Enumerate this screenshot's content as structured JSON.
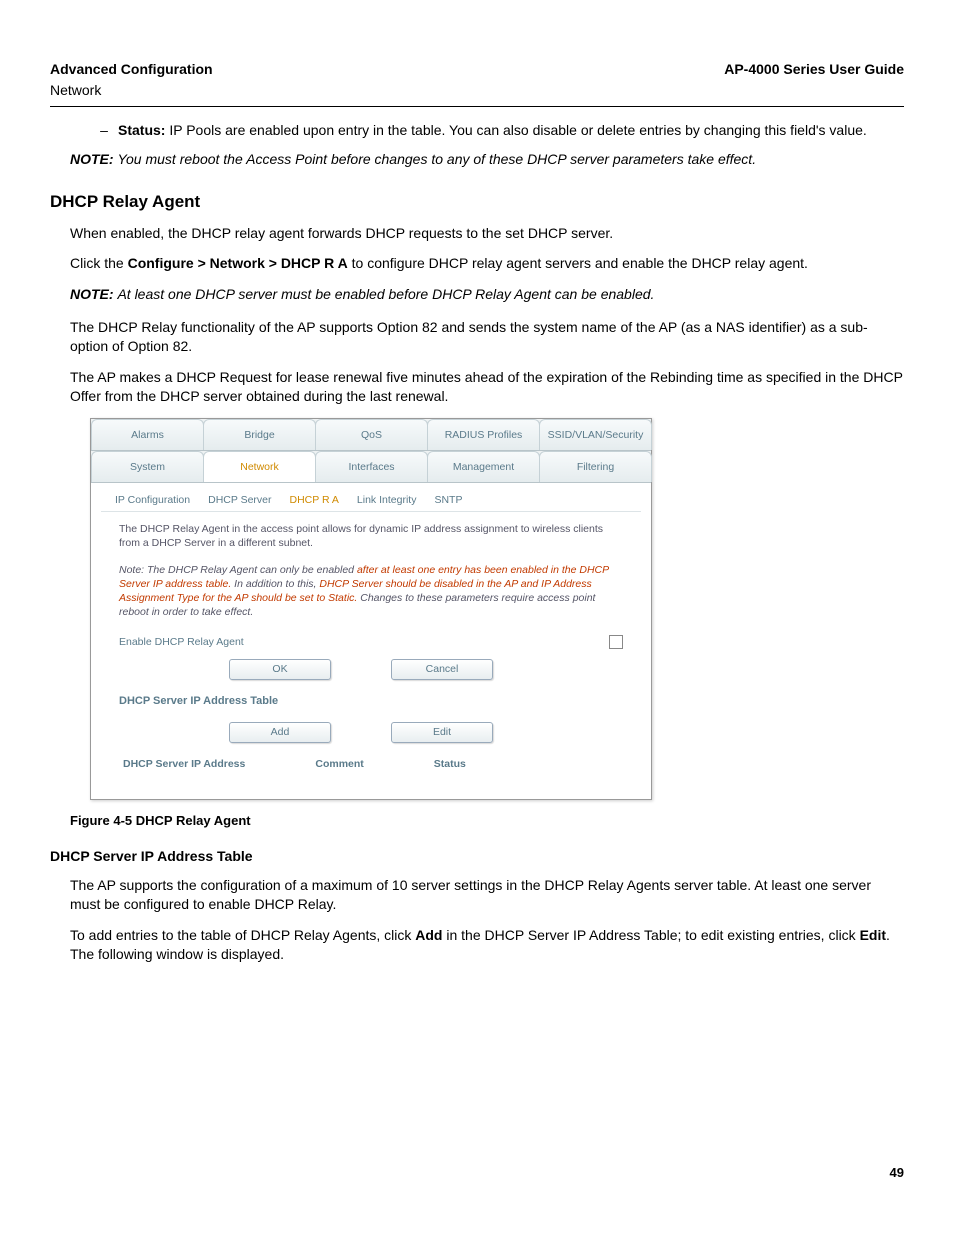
{
  "header": {
    "left": "Advanced Configuration",
    "right": "AP-4000 Series User Guide",
    "sub": "Network"
  },
  "status_item": {
    "label": "Status:",
    "text": " IP Pools are enabled upon entry in the table. You can also disable or delete entries by changing this field's value."
  },
  "note1": {
    "label": "NOTE:  ",
    "text": "You must reboot the Access Point before changes to any of these DHCP server parameters take effect."
  },
  "section_title": "DHCP Relay Agent",
  "p1": "When enabled, the DHCP relay agent forwards DHCP requests to the set DHCP server.",
  "p2a": "Click the ",
  "p2b": "Configure > Network > DHCP R A",
  "p2c": " to configure DHCP relay agent servers and enable the DHCP relay agent.",
  "note2": {
    "label": "NOTE:  ",
    "text": "At least one DHCP server must be enabled before DHCP Relay Agent can be enabled."
  },
  "p3": "The DHCP Relay functionality of the AP supports Option 82 and sends the system name of the AP (as a NAS identifier) as a sub-option of Option 82.",
  "p4": "The AP makes a DHCP Request for lease renewal five minutes ahead of the expiration of the Rebinding time as specified in the DHCP Offer from the DHCP server obtained during the last renewal.",
  "shot": {
    "tabs_top": [
      "Alarms",
      "Bridge",
      "QoS",
      "RADIUS Profiles",
      "SSID/VLAN/Security"
    ],
    "tabs_bot": [
      "System",
      "Network",
      "Interfaces",
      "Management",
      "Filtering"
    ],
    "tabs_bot_active": "Network",
    "subtabs": [
      "IP Configuration",
      "DHCP Server",
      "DHCP R A",
      "Link Integrity",
      "SNTP"
    ],
    "subtab_active": "DHCP R A",
    "intro": "The DHCP Relay Agent in the access point allows for dynamic IP address assignment to wireless clients from a DHCP Server in a different subnet.",
    "note_pre": "Note: The DHCP Relay Agent can only be enabled ",
    "note_red1": "after at least one entry has been enabled in the DHCP Server IP address table.",
    "note_mid": " In addition to this, ",
    "note_red2": "DHCP Server should be disabled in the AP and IP Address Assignment Type for the AP should be set to Static.",
    "note_post": " Changes to these parameters require access point reboot in order to take effect.",
    "enable_label": "Enable DHCP Relay Agent",
    "btn_ok": "OK",
    "btn_cancel": "Cancel",
    "table_title": "DHCP Server IP Address Table",
    "btn_add": "Add",
    "btn_edit": "Edit",
    "col1": "DHCP Server IP Address",
    "col2": "Comment",
    "col3": "Status"
  },
  "fig_caption": "Figure 4-5 DHCP Relay Agent",
  "sub_heading": "DHCP Server IP Address Table",
  "p5": "The AP supports the configuration of a maximum of 10 server settings in the DHCP Relay Agents server table. At least one server must be configured to enable DHCP Relay.",
  "p6a": "To add entries to the table of DHCP Relay Agents, click ",
  "p6b": "Add",
  "p6c": " in the DHCP Server IP Address Table; to edit existing entries, click ",
  "p6d": "Edit",
  "p6e": ". The following window is displayed.",
  "page_no": "49"
}
